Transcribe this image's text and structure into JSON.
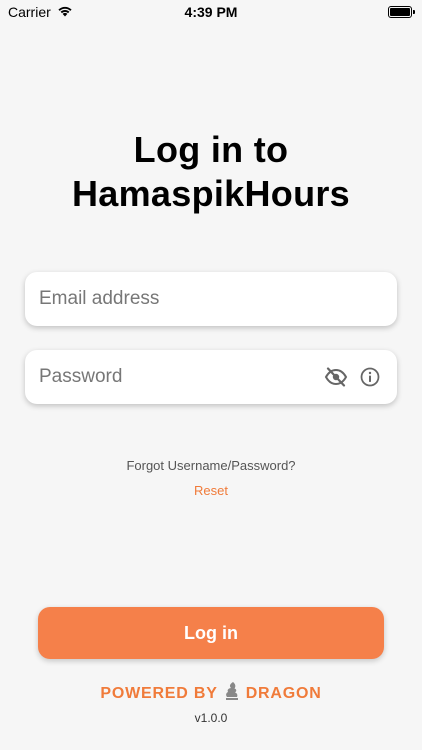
{
  "status_bar": {
    "carrier": "Carrier",
    "time": "4:39 PM"
  },
  "title": {
    "line1": "Log in to",
    "line2": "HamaspikHours"
  },
  "email_field": {
    "value": "",
    "placeholder": "Email address"
  },
  "password_field": {
    "value": "",
    "placeholder": "Password",
    "visibility_icon": "eye-off-icon",
    "info_icon": "info-icon"
  },
  "forgot": {
    "text": "Forgot Username/Password?",
    "reset_label": "Reset"
  },
  "login_button": {
    "label": "Log in"
  },
  "footer": {
    "powered_prefix": "POWERED BY",
    "brand": "DRAGON",
    "logo_icon": "dragon-logo-icon",
    "version": "v1.0.0"
  },
  "colors": {
    "accent": "#f5804a",
    "accent_text": "#f07b3a",
    "background": "#f6f6f6"
  }
}
